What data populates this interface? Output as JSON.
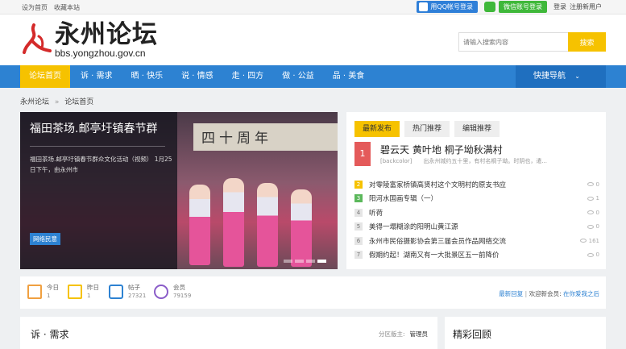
{
  "topbar": {
    "set_home": "设为首页",
    "bookmark": "收藏本站",
    "qq_login": "用QQ帐号登录",
    "wechat_login": "微信账号登录",
    "login": "登录",
    "register": "注册新用户"
  },
  "header": {
    "logo_cn": "永州论坛",
    "logo_en": "bbs.yongzhou.gov.cn",
    "search_placeholder": "请输入搜索内容",
    "search_button": "搜索"
  },
  "nav": {
    "items": [
      "论坛首页",
      "诉 · 需求",
      "晒 · 快乐",
      "说 · 情感",
      "走 · 四方",
      "做 · 公益",
      "品 · 美食"
    ],
    "quick": "快捷导航"
  },
  "breadcrumb": {
    "root": "永州论坛",
    "sep": "»",
    "current": "论坛首页"
  },
  "slider": {
    "title": "福田茶场.邮亭圩镇春节群",
    "desc": "福田茶场.邮亭圩镇春节群众文化活动（视频） 1月25日下午，由永州市",
    "tag": "网络民意",
    "sign_text": "四十周年"
  },
  "hot": {
    "tabs": [
      "最新发布",
      "热门推荐",
      "编辑推荐"
    ],
    "top": {
      "rank": "1",
      "title": "碧云天 黄叶地 桐子坳秋满村",
      "desc": "[backcolor]　　出永州城约五十里，有村名桐子坳。时阴也，遣..."
    },
    "list": [
      {
        "rank": "2",
        "title": "对零陵富家桥镇高贤村这个文明村的原支书应",
        "count": "0"
      },
      {
        "rank": "3",
        "title": "阳河水国画专辑（一）",
        "count": "1"
      },
      {
        "rank": "4",
        "title": "听荷",
        "count": "0"
      },
      {
        "rank": "5",
        "title": "美得一塌糊涂的阳明山黄江源",
        "count": "0"
      },
      {
        "rank": "6",
        "title": "永州市民俗摄影协会第三届会员作品网络交流",
        "count": "161"
      },
      {
        "rank": "7",
        "title": "假期约起！湖南又有一大批景区五一前降价",
        "count": "0"
      }
    ]
  },
  "stats": {
    "today_label": "今日",
    "today": "1",
    "yesterday_label": "昨日",
    "yesterday": "1",
    "posts_label": "帖子",
    "posts": "27321",
    "members_label": "会员",
    "members": "79159",
    "latest_reply": "最新回复",
    "welcome": "欢迎新会员:",
    "new_member": "在你爱我之后"
  },
  "section1": {
    "title": "诉 · 需求",
    "mod_label": "分区版主:",
    "mod": "管理员"
  },
  "section2": {
    "title": "精彩回顾"
  },
  "colors": {
    "accent": "#f6c200",
    "nav": "#2d82d2",
    "rank1": "#e45a5a"
  }
}
